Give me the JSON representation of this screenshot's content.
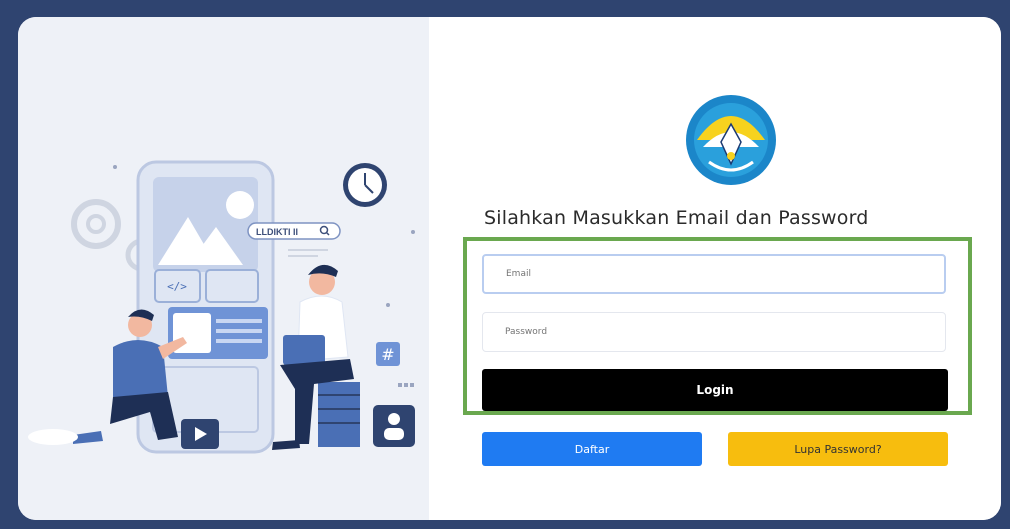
{
  "illustration": {
    "search_chip_label": "LLDIKTI II",
    "code_tag": "</>",
    "hash_tag": "#"
  },
  "login": {
    "heading": "Silahkan Masukkan Email dan Password",
    "email_placeholder": "Email",
    "password_placeholder": "Password",
    "login_label": "Login",
    "register_label": "Daftar",
    "forgot_label": "Lupa Password?"
  },
  "colors": {
    "background": "#2f4470",
    "highlight": "#6aa84f",
    "login_button": "#000000",
    "register_button": "#1f7bf2",
    "forgot_button": "#f7bd0e"
  },
  "icons": [
    "gear-icon",
    "clock-icon",
    "search-icon",
    "code-icon",
    "hash-icon",
    "play-icon",
    "user-icon",
    "tut-wuri-handayani-logo"
  ]
}
